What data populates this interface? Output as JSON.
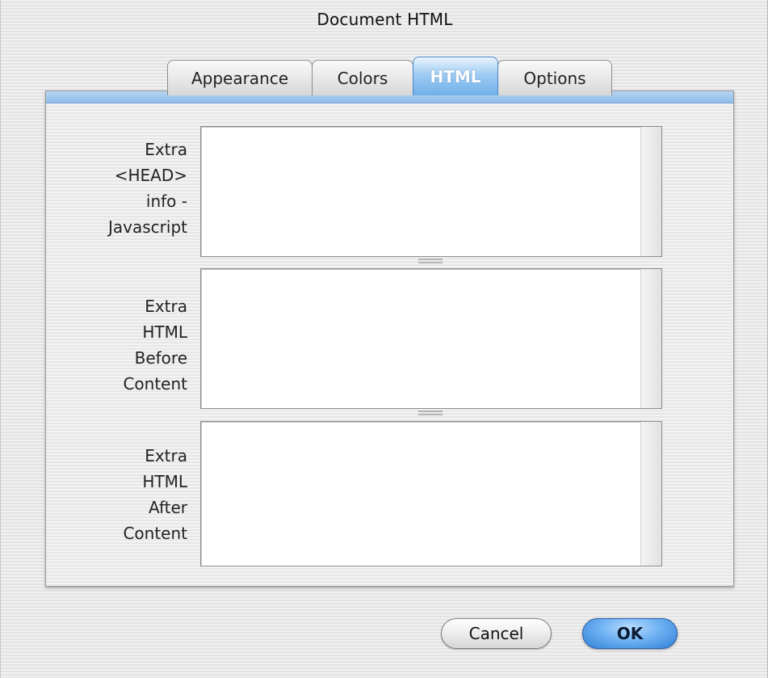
{
  "window": {
    "title": "Document HTML"
  },
  "tabs": [
    {
      "label": "Appearance",
      "active": false
    },
    {
      "label": "Colors",
      "active": false
    },
    {
      "label": "HTML",
      "active": true
    },
    {
      "label": "Options",
      "active": false
    }
  ],
  "fields": [
    {
      "label_lines": [
        "Extra",
        "<HEAD>",
        "info -",
        "Javascript"
      ],
      "value": ""
    },
    {
      "label_lines": [
        "Extra",
        "HTML",
        "Before",
        "Content"
      ],
      "value": ""
    },
    {
      "label_lines": [
        "Extra",
        "HTML",
        "After",
        "Content"
      ],
      "value": ""
    }
  ],
  "buttons": {
    "cancel_label": "Cancel",
    "ok_label": "OK"
  },
  "colors": {
    "active_tab": "#6fb0ea",
    "default_button": "#2f7fd6"
  }
}
